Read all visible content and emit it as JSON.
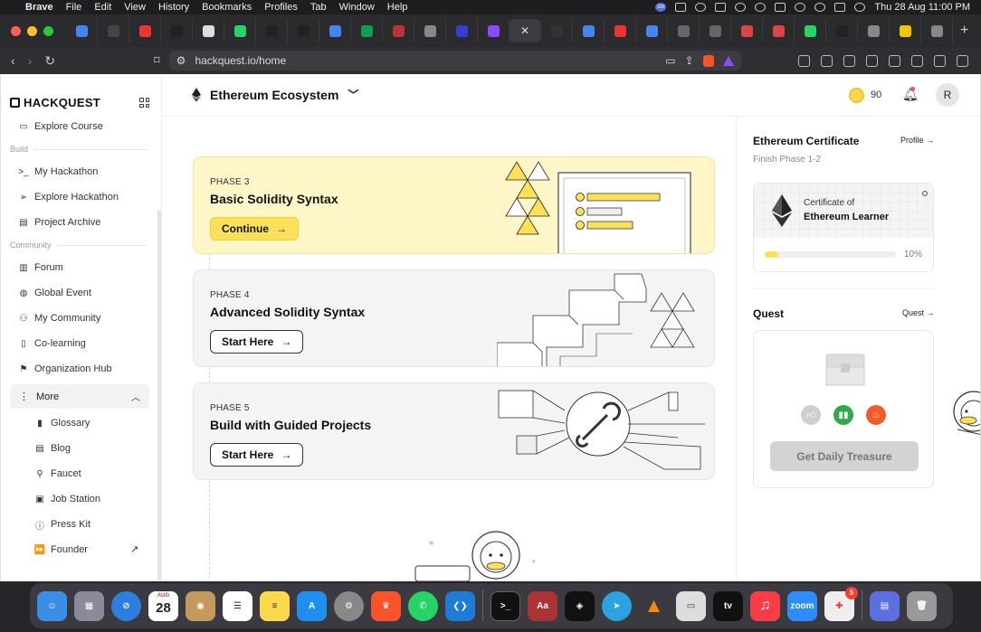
{
  "menubar": {
    "app_name": "Brave",
    "menus": [
      "File",
      "Edit",
      "View",
      "History",
      "Bookmarks",
      "Profiles",
      "Tab",
      "Window",
      "Help"
    ],
    "datetime": "Thu 28 Aug  11:00 PM",
    "zm_label": "zm"
  },
  "browser": {
    "url": "hackquest.io/home",
    "active_tab_glyph": "✕",
    "new_tab_glyph": "+",
    "tab_favicons": [
      "#4285f4",
      "#444",
      "#e33",
      "#222",
      "#ddd",
      "#25d366",
      "#222",
      "#222",
      "#4285f4",
      "#0f9d58",
      "#b33",
      "#888",
      "#3b3bd8",
      "#8b4aff",
      "#333",
      "#4285f4",
      "#e33",
      "#4285f4",
      "#666",
      "#666",
      "#d44",
      "#d44",
      "#25d366",
      "#222",
      "#888",
      "#f5c400",
      "#888"
    ]
  },
  "sidebar": {
    "logo": "HACKQUEST",
    "explore_course": "Explore Course",
    "build_label": "Build",
    "build_items": [
      "My Hackathon",
      "Explore Hackathon",
      "Project Archive"
    ],
    "community_label": "Community",
    "community_items": [
      "Forum",
      "Global Event",
      "My Community",
      "Co-learning",
      "Organization Hub"
    ],
    "more_label": "More",
    "more_items": [
      "Glossary",
      "Blog",
      "Faucet",
      "Job Station",
      "Press Kit",
      "Founder"
    ]
  },
  "header": {
    "ecosystem": "Ethereum Ecosystem",
    "coins": "90",
    "avatar_initial": "R"
  },
  "phases": [
    {
      "phase": "PHASE 3",
      "title": "Basic Solidity Syntax",
      "button": "Continue",
      "active": true
    },
    {
      "phase": "PHASE 4",
      "title": "Advanced Solidity Syntax",
      "button": "Start Here",
      "active": false
    },
    {
      "phase": "PHASE 5",
      "title": "Build with Guided Projects",
      "button": "Start Here",
      "active": false
    }
  ],
  "certificate": {
    "title": "Ethereum Certificate",
    "profile_link": "Profile",
    "subtitle": "Finish Phase 1-2",
    "cert_of": "Certificate of",
    "cert_name": "Ethereum Learner",
    "progress_label": "10%",
    "progress": 0.1
  },
  "quest": {
    "title": "Quest",
    "link": "Quest",
    "button": "Get Daily Treasure"
  },
  "dock": {
    "calendar_month": "AUG",
    "calendar_day": "28",
    "text_icons": [
      "Aa",
      "tv",
      "zoom"
    ],
    "appstore_badge": "5"
  },
  "colors": {
    "accent_yellow": "#fce05a",
    "active_card_bg": "#fff6c7",
    "inactive_card_bg": "#f4f4f4",
    "disabled_button": "#d3d3d3"
  }
}
